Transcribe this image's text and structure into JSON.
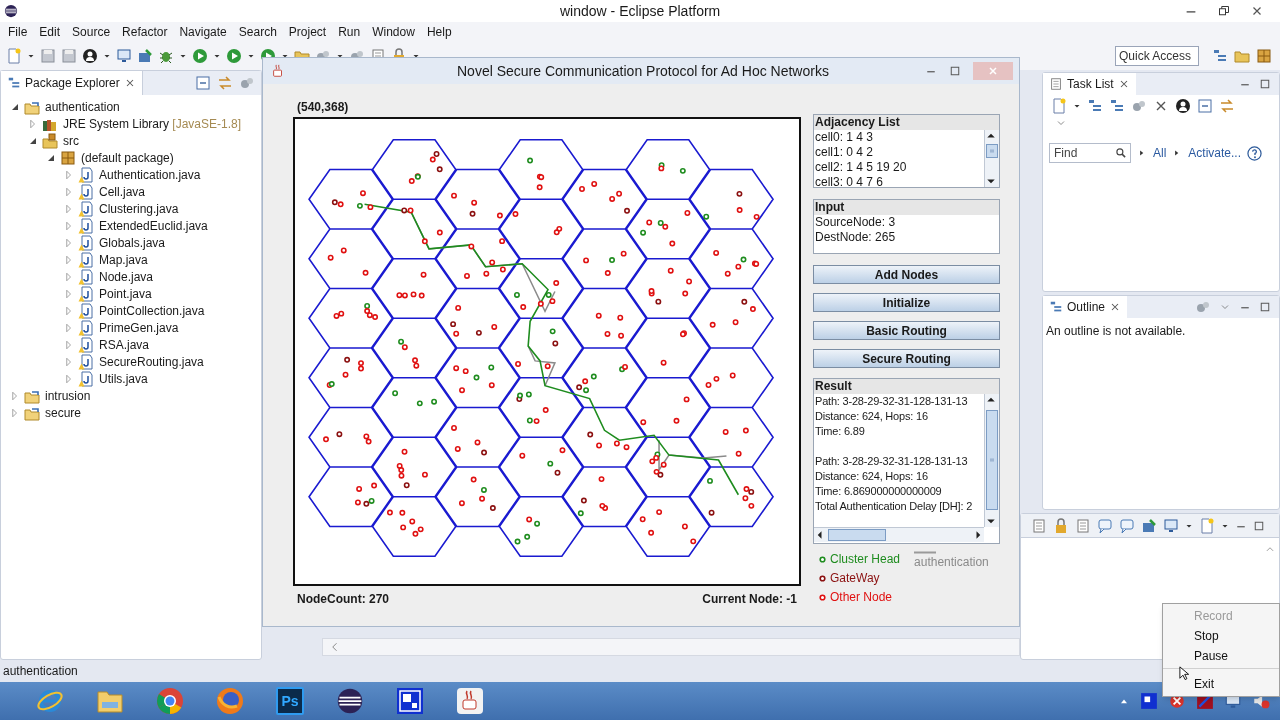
{
  "window": {
    "title": "window - Eclipse Platform"
  },
  "menu": [
    "File",
    "Edit",
    "Source",
    "Refactor",
    "Navigate",
    "Search",
    "Project",
    "Run",
    "Window",
    "Help"
  ],
  "quick_access": {
    "placeholder": "Quick Access"
  },
  "package_explorer": {
    "title": "Package Explorer",
    "tree": [
      {
        "label": "authentication",
        "kind": "project",
        "expanded": true,
        "children": [
          {
            "label": "JRE System Library",
            "suffix": "[JavaSE-1.8]",
            "kind": "library",
            "expanded": false
          },
          {
            "label": "src",
            "kind": "source",
            "expanded": true,
            "children": [
              {
                "label": "(default package)",
                "kind": "package",
                "expanded": true,
                "children": [
                  {
                    "label": "Authentication.java",
                    "kind": "file",
                    "expanded": false
                  },
                  {
                    "label": "Cell.java",
                    "kind": "file",
                    "expanded": false
                  },
                  {
                    "label": "Clustering.java",
                    "kind": "file",
                    "expanded": false
                  },
                  {
                    "label": "ExtendedEuclid.java",
                    "kind": "file",
                    "expanded": false
                  },
                  {
                    "label": "Globals.java",
                    "kind": "file",
                    "expanded": false
                  },
                  {
                    "label": "Map.java",
                    "kind": "file",
                    "expanded": false
                  },
                  {
                    "label": "Node.java",
                    "kind": "file",
                    "expanded": false
                  },
                  {
                    "label": "Point.java",
                    "kind": "file",
                    "expanded": false
                  },
                  {
                    "label": "PointCollection.java",
                    "kind": "file",
                    "expanded": false
                  },
                  {
                    "label": "PrimeGen.java",
                    "kind": "file",
                    "expanded": false
                  },
                  {
                    "label": "RSA.java",
                    "kind": "file",
                    "expanded": false
                  },
                  {
                    "label": "SecureRouting.java",
                    "kind": "file",
                    "expanded": false
                  },
                  {
                    "label": "Utils.java",
                    "kind": "file",
                    "expanded": false
                  }
                ]
              }
            ]
          }
        ]
      },
      {
        "label": "intrusion",
        "kind": "project",
        "expanded": false
      },
      {
        "label": "secure",
        "kind": "project",
        "expanded": false
      }
    ]
  },
  "task_list": {
    "title": "Task List",
    "find": {
      "placeholder": "Find"
    },
    "links": [
      "All",
      "Activate..."
    ]
  },
  "outline": {
    "title": "Outline",
    "message": "An outline is not available."
  },
  "status_bar": "authentication",
  "app": {
    "title": "Novel Secure Communication Protocol for Ad Hoc Networks",
    "coordinates": "(540,368)",
    "node_count": "NodeCount: 270",
    "current_node": "Current Node: -1",
    "adjacency": {
      "title": "Adjacency List",
      "lines": [
        "cell0: 1 4 3",
        "cell1: 0 4 2",
        "cell2: 1 4 5 19 20",
        "cell3: 0 4 7 6"
      ]
    },
    "input": {
      "title": "Input",
      "lines": [
        "SourceNode: 3",
        "DestNode: 265"
      ]
    },
    "buttons": [
      "Add Nodes",
      "Initialize",
      "Basic Routing",
      "Secure Routing"
    ],
    "result": {
      "title": "Result",
      "blocks": [
        [
          "Path: 3-28-29-32-31-128-131-13",
          "Distance: 624, Hops: 16",
          "Time: 6.89"
        ],
        [
          "Path: 3-28-29-32-31-128-131-13",
          "Distance: 624, Hops: 16",
          "Time: 6.869000000000009",
          "Total Authentication Delay [DH]: 2"
        ]
      ]
    },
    "legend": [
      {
        "label": "Cluster Head",
        "color": "#1e8c1e"
      },
      {
        "label": "GateWay",
        "color": "#8b1010"
      },
      {
        "label": "Other Node",
        "color": "#e01010"
      }
    ],
    "link_legend": "authentication"
  },
  "taskbar": [
    {
      "kind": "ie"
    },
    {
      "kind": "explorer"
    },
    {
      "kind": "chrome"
    },
    {
      "kind": "firefox"
    },
    {
      "kind": "photoshop",
      "label": "Ps"
    },
    {
      "kind": "eclipse"
    },
    {
      "kind": "square"
    },
    {
      "kind": "java"
    }
  ],
  "tray_menu": [
    {
      "label": "Record",
      "disabled": true,
      "separator_before": false
    },
    {
      "label": "Stop",
      "disabled": false,
      "separator_before": false
    },
    {
      "label": "Pause",
      "disabled": false,
      "separator_before": false
    },
    {
      "label": "Exit",
      "disabled": false,
      "separator_before": true
    }
  ]
}
